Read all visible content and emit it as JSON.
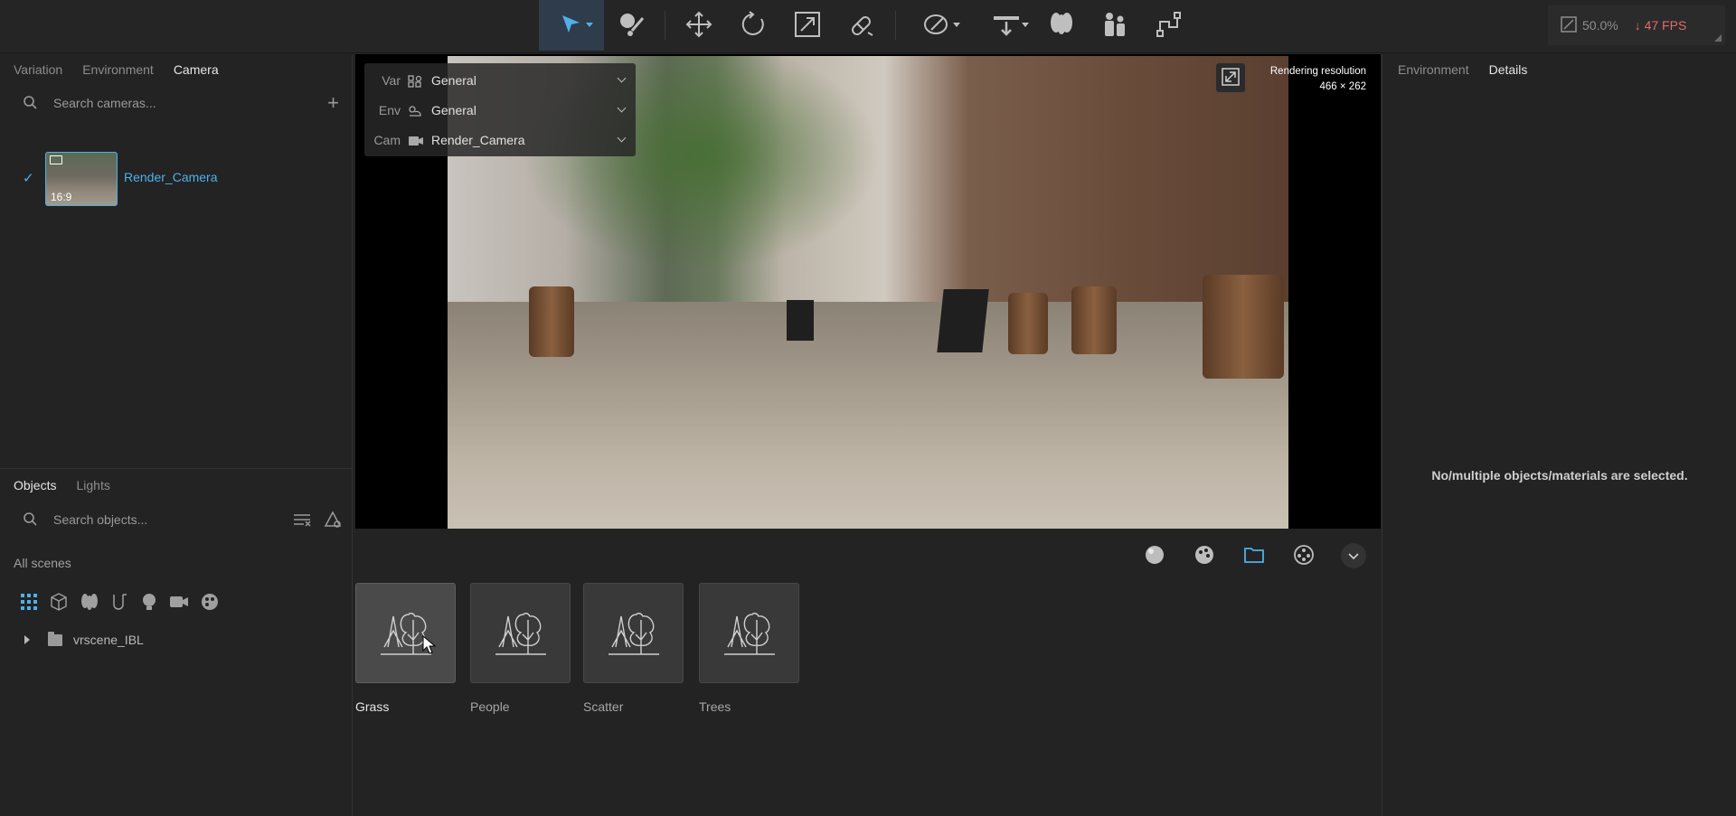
{
  "toolbar": {
    "tools": [
      {
        "name": "select-tool",
        "icon": "cursor-arrow-icon",
        "active": true
      },
      {
        "name": "paint-tool",
        "icon": "paint-brush-icon"
      },
      {
        "name": "move-tool",
        "icon": "move-arrows-icon"
      },
      {
        "name": "rotate-tool",
        "icon": "rotate-icon"
      },
      {
        "name": "scale-tool",
        "icon": "scale-icon"
      },
      {
        "name": "snap-tool",
        "icon": "magnet-icon"
      },
      {
        "name": "draw-tool",
        "icon": "pen-icon"
      },
      {
        "name": "drop-tool",
        "icon": "drop-to-ground-icon"
      },
      {
        "name": "scatter-tool",
        "icon": "trees-icon"
      },
      {
        "name": "people-tool",
        "icon": "people-icon"
      },
      {
        "name": "path-tool",
        "icon": "path-icon"
      }
    ],
    "stats": {
      "zoom": "50.0%",
      "fps": "47 FPS"
    }
  },
  "left_panel": {
    "tabs": [
      "Variation",
      "Environment",
      "Camera"
    ],
    "active_tab": "Camera",
    "camera_search_placeholder": "Search cameras...",
    "camera": {
      "name": "Render_Camera",
      "aspect": "16:9"
    },
    "lower_tabs": [
      "Objects",
      "Lights"
    ],
    "lower_active_tab": "Objects",
    "object_search_placeholder": "Search objects...",
    "scenes_label": "All scenes",
    "filter_icons": [
      "grid-icon",
      "cube-icon",
      "tree-icon",
      "curve-icon",
      "light-bulb-icon",
      "camera-icon",
      "palette-icon"
    ],
    "tree": [
      {
        "label": "vrscene_IBL"
      }
    ]
  },
  "viewport": {
    "overlay": [
      {
        "key": "Var",
        "icon": "variation-icon",
        "value": "General"
      },
      {
        "key": "Env",
        "icon": "environment-icon",
        "value": "General"
      },
      {
        "key": "Cam",
        "icon": "camera-icon",
        "value": "Render_Camera"
      }
    ],
    "resolution_label": "Rendering resolution",
    "resolution_value": "466 × 262"
  },
  "asset_bar": {
    "icons": [
      "sphere-icon",
      "palette-icon",
      "folder-icon",
      "film-reel-icon",
      "chevron-down-icon"
    ],
    "active_icon": "folder-icon"
  },
  "assets": [
    {
      "label": "Grass",
      "icon": "trees-icon",
      "selected": true
    },
    {
      "label": "People",
      "icon": "trees-icon"
    },
    {
      "label": "Scatter",
      "icon": "trees-icon"
    },
    {
      "label": "Trees",
      "icon": "trees-icon"
    }
  ],
  "right_panel": {
    "tabs": [
      "Environment",
      "Details"
    ],
    "active_tab": "Details",
    "empty_message": "No/multiple objects/materials are selected."
  },
  "colors": {
    "accent": "#4fb0ea",
    "fps_warning": "#e26a6a",
    "background": "#232323"
  }
}
